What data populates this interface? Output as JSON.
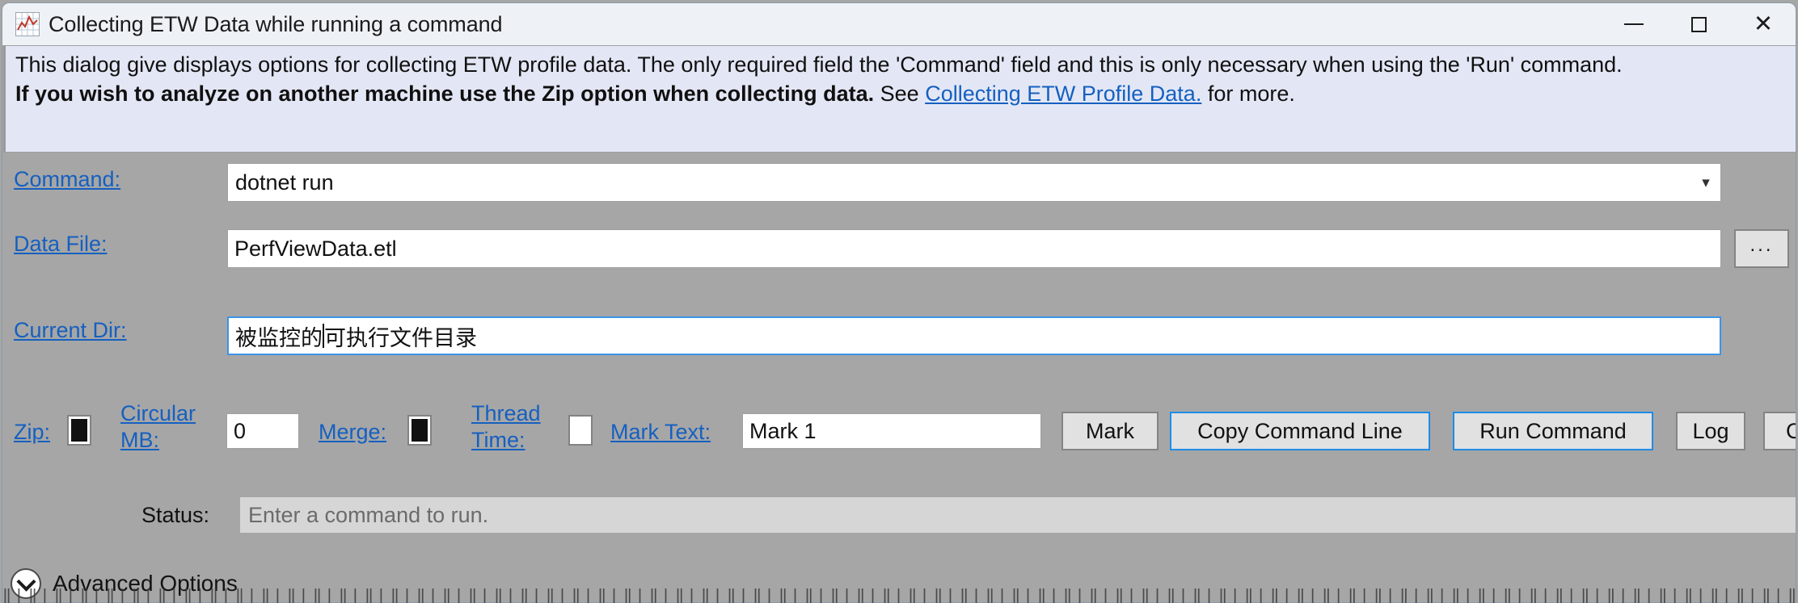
{
  "window": {
    "title": "Collecting ETW Data while running a command",
    "title_icon": "chart-icon",
    "minimize_label": "—",
    "maximize_label": "□",
    "close_label": "✕"
  },
  "banner": {
    "line1": "This dialog give displays options for collecting ETW profile data. The only required field the 'Command' field and this is only necessary when using the",
    "line2": "'Run' command.",
    "line3_bold": "If you wish to analyze on another machine use the Zip option when collecting data.",
    "line3_see": "See",
    "line3_link": "Collecting ETW Profile Data.",
    "line3_tail": "for more."
  },
  "fields": {
    "command": {
      "label": "Command:",
      "value": "dotnet run",
      "dropdown_arrow": "chevron-down-icon"
    },
    "data_file": {
      "label": "Data File:",
      "value": "PerfViewData.etl",
      "browse_label": "..."
    },
    "current_dir": {
      "label": "Current Dir:",
      "value_before_caret": "被监控的",
      "value_after_caret": "可执行文件目录",
      "value": "被监控的可执行文件目录",
      "focused": true
    }
  },
  "options": {
    "zip": {
      "label": "Zip:",
      "checked": true
    },
    "circular_mb": {
      "label_line1": "Circular",
      "label_line2": "MB:",
      "value": "0"
    },
    "merge": {
      "label": "Merge:",
      "checked": true
    },
    "thread_time": {
      "label_line1": "Thread",
      "label_line2": "Time:",
      "checked": false
    },
    "mark_text": {
      "label": "Mark Text:",
      "value": "Mark 1"
    }
  },
  "buttons": {
    "mark": "Mark",
    "copy_command_line": "Copy Command Line",
    "run_command": "Run Command",
    "log": "Log",
    "cancel": "Cancel",
    "cancel_visible": "Ca"
  },
  "status": {
    "label": "Status:",
    "text": "Enter a command to run."
  },
  "advanced": {
    "label": "Advanced Options",
    "icon": "chevron-down-circle-icon",
    "expanded": false
  },
  "colors": {
    "window_background": "#a6a6a6",
    "titlebar": "#eef2f7",
    "banner_background": "#e3e7f5",
    "link": "#1560c0",
    "accent_border": "#1e8ce8",
    "button_face": "#e1e1e1",
    "status_field": "#d6d6d6",
    "text": "#111111"
  },
  "behind": {
    "top_strip": "┐  ┌─┐─  ─┐─┐──┌  ─ ─────",
    "bottom_strip": "║│║│║│║│║│║│║│║│║│║│║│║│║│║│║│║│║│║│║│║│║│║│║│║│║│║│║│║│║│║│║│║│║│║│║│║│║│║│║│║│║│║│║│║│║│║│║│║│║│║│║│║│║│║│║│║│║│║│║│║│║│║│║│║│║│║│║│║│║│║│║│║│║│║│"
  }
}
